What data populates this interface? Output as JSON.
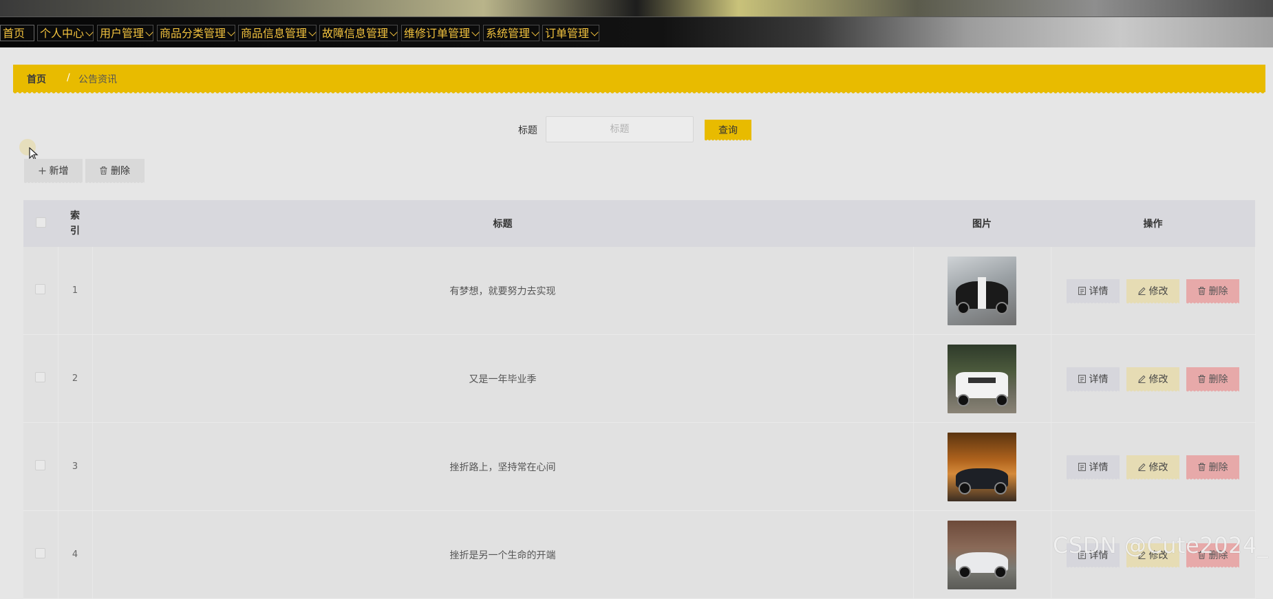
{
  "nav": {
    "home": "首页",
    "items": [
      {
        "label": "个人中心"
      },
      {
        "label": "用户管理"
      },
      {
        "label": "商品分类管理"
      },
      {
        "label": "商品信息管理"
      },
      {
        "label": "故障信息管理"
      },
      {
        "label": "维修订单管理"
      },
      {
        "label": "系统管理"
      },
      {
        "label": "订单管理"
      }
    ]
  },
  "breadcrumb": {
    "home": "首页",
    "separator": "/",
    "current": "公告资讯"
  },
  "search": {
    "label": "标题",
    "placeholder": "标题",
    "button": "查询"
  },
  "actions": {
    "add": "新增",
    "delete": "删除"
  },
  "table": {
    "headers": {
      "index": "索引",
      "title": "标题",
      "image": "图片",
      "operation": "操作"
    },
    "rows": [
      {
        "index": "1",
        "title": "有梦想，就要努力去实现",
        "image_icon": "car-photo-black-stripe"
      },
      {
        "index": "2",
        "title": "又是一年毕业季",
        "image_icon": "car-photo-white-suv"
      },
      {
        "index": "3",
        "title": "挫折路上，坚持常在心间",
        "image_icon": "car-photo-sunset"
      },
      {
        "index": "4",
        "title": "挫折是另一个生命的开端",
        "image_icon": "car-photo-white-sedan"
      }
    ],
    "row_buttons": {
      "detail": "详情",
      "edit": "修改",
      "delete": "删除"
    }
  },
  "watermark": "CSDN @Cute2024_",
  "colors": {
    "accent": "#e8bb00",
    "nav_text": "#f2c23e",
    "delete": "#e7a9a9",
    "edit": "#e6dcb4"
  }
}
